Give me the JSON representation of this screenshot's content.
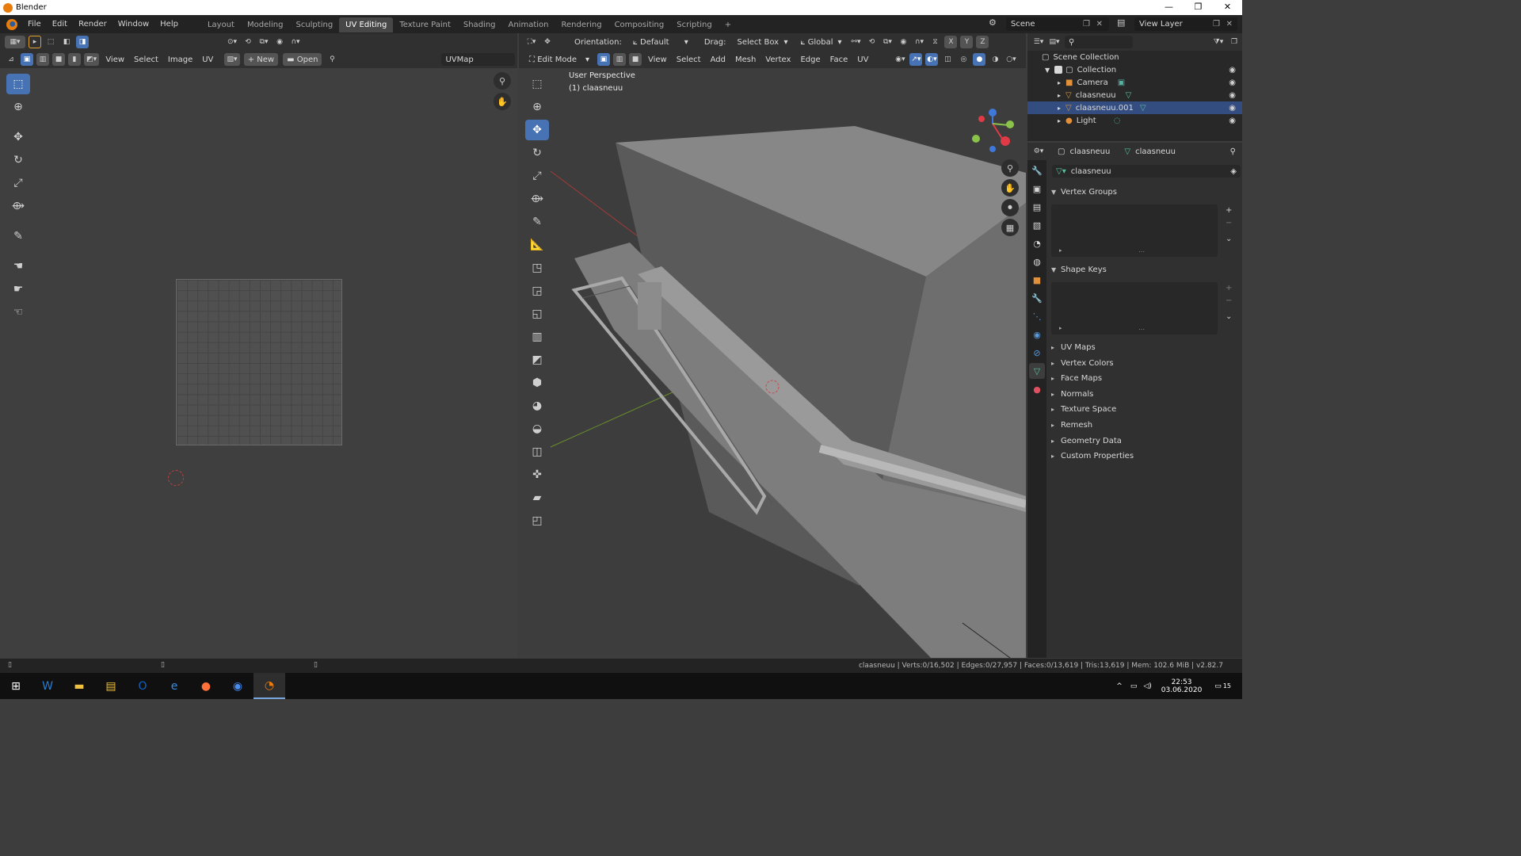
{
  "window": {
    "title": "Blender",
    "controls": [
      "—",
      "❐",
      "✕"
    ]
  },
  "topbar": {
    "menus": [
      "File",
      "Edit",
      "Render",
      "Window",
      "Help"
    ],
    "tabs": [
      "Layout",
      "Modeling",
      "Sculpting",
      "UV Editing",
      "Texture Paint",
      "Shading",
      "Animation",
      "Rendering",
      "Compositing",
      "Scripting"
    ],
    "active_tab": "UV Editing",
    "add_tab": "+",
    "scene": "Scene",
    "view_layer": "View Layer"
  },
  "uv_editor": {
    "menus": [
      "View",
      "Select",
      "Image",
      "UV"
    ],
    "new_label": "New",
    "open_label": "Open",
    "uvmap": "UVMap"
  },
  "viewport": {
    "orientation_label": "Orientation:",
    "orientation_value": "Default",
    "drag_label": "Drag:",
    "drag_value": "Select Box",
    "transform_space": "Global",
    "mode": "Edit Mode",
    "menus": [
      "View",
      "Select",
      "Add",
      "Mesh",
      "Vertex",
      "Edge",
      "Face",
      "UV"
    ],
    "axes": [
      "X",
      "Y",
      "Z"
    ],
    "perspective": "User Perspective",
    "object": "(1) claasneuu"
  },
  "outliner": {
    "root": "Scene Collection",
    "items": [
      {
        "name": "Collection",
        "color": "#d8d8d8"
      },
      {
        "name": "Camera",
        "color": "#d8d8d8"
      },
      {
        "name": "claasneuu",
        "color": "#d8d8d8"
      },
      {
        "name": "claasneuu.001",
        "color": "#ffffff"
      },
      {
        "name": "Light",
        "color": "#d8d8d8"
      }
    ]
  },
  "properties": {
    "object_name": "claasneuu",
    "data_name": "claasneuu",
    "mesh_name": "claasneuu",
    "panels": {
      "vertex_groups": "Vertex Groups",
      "shape_keys": "Shape Keys",
      "uv_maps": "UV Maps",
      "vertex_colors": "Vertex Colors",
      "face_maps": "Face Maps",
      "normals": "Normals",
      "texture_space": "Texture Space",
      "remesh": "Remesh",
      "geometry_data": "Geometry Data",
      "custom_properties": "Custom Properties"
    }
  },
  "statusbar": {
    "stats": "claasneuu | Verts:0/16,502 | Edges:0/27,957 | Faces:0/13,619 | Tris:13,619 | Mem: 102.6 MiB | v2.82.7"
  },
  "taskbar": {
    "time": "22:53",
    "date": "03.06.2020",
    "notifications": "15"
  },
  "colors": {
    "accent": "#4772b3",
    "selected_row": "#334d80",
    "header": "#303030",
    "topbar": "#232323"
  }
}
